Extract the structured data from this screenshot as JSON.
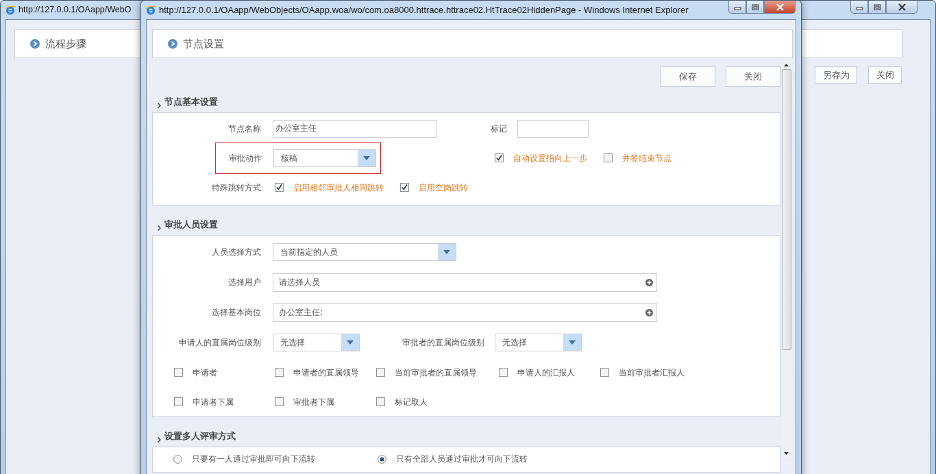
{
  "back_window": {
    "title": "http://127.0.0.1/OAapp/WebO",
    "header": "流程步骤",
    "buttons": [
      "另存为",
      "关闭"
    ]
  },
  "dialog": {
    "title": "http://127.0.0.1/OAapp/WebObjects/OAapp.woa/wo/com.oa8000.httrace.httrace02.HtTrace02HiddenPage - Windows Internet Explorer",
    "header": "节点设置",
    "buttons": [
      "保存",
      "关闭"
    ]
  },
  "sections": [
    {
      "title": "节点基本设置",
      "rows": [
        {
          "items": [
            {
              "kind": "text",
              "label": "节点名称",
              "value": "办公室主任"
            },
            {
              "kind": "text",
              "label": "标记"
            }
          ]
        },
        {
          "items": [
            {
              "kind": "select",
              "label": "审批动作",
              "value": "核稿",
              "highlighted": true
            },
            {
              "kind": "check",
              "text": "自动设置指向上一步",
              "checked": true
            },
            {
              "kind": "check",
              "text": "并签结束节点",
              "checked": false
            }
          ]
        },
        {
          "items": [
            {
              "kind": "label",
              "label": "特殊跳转方式"
            },
            {
              "kind": "check",
              "text": "启用相邻审批人相同跳转",
              "checked": true
            },
            {
              "kind": "check",
              "text": "启用空岗跳转",
              "checked": true
            }
          ]
        }
      ]
    },
    {
      "title": "审批人员设置",
      "rows": [
        {
          "items": [
            {
              "kind": "select",
              "label": "人员选择方式",
              "value": "当前指定的人员"
            }
          ]
        },
        {
          "items": [
            {
              "kind": "picker",
              "label": "选择用户",
              "placeholder": "请选择人员"
            }
          ]
        },
        {
          "items": [
            {
              "kind": "picker",
              "label": "选择基本岗位",
              "value": "办公室主任;"
            }
          ]
        },
        {
          "items": [
            {
              "kind": "select",
              "label": "申请人的直属岗位级别",
              "value": "无选择"
            },
            {
              "kind": "select",
              "label": "审批者的直属岗位级别",
              "value": "无选择"
            }
          ]
        },
        {
          "items": [
            {
              "kind": "check",
              "text": "申请者",
              "checked": false
            },
            {
              "kind": "check",
              "text": "申请者的直属领导",
              "checked": false
            },
            {
              "kind": "check",
              "text": "当前审批者的直属领导",
              "checked": false
            },
            {
              "kind": "check",
              "text": "申请人的汇报人",
              "checked": false
            },
            {
              "kind": "check",
              "text": "当前审批者汇报人",
              "checked": false
            }
          ]
        },
        {
          "items": [
            {
              "kind": "check",
              "text": "申请者下属",
              "checked": false
            },
            {
              "kind": "check",
              "text": "审批者下属",
              "checked": false
            },
            {
              "kind": "check",
              "text": "标记取人",
              "checked": false
            }
          ]
        }
      ]
    },
    {
      "title": "设置多人评审方式",
      "rows": [
        {
          "items": [
            {
              "kind": "radio",
              "text": "只要有一人通过审批即可向下流转",
              "selected": false
            },
            {
              "kind": "radio",
              "text": "只有全部人员通过审批才可向下流转",
              "selected": true
            }
          ]
        }
      ]
    }
  ]
}
